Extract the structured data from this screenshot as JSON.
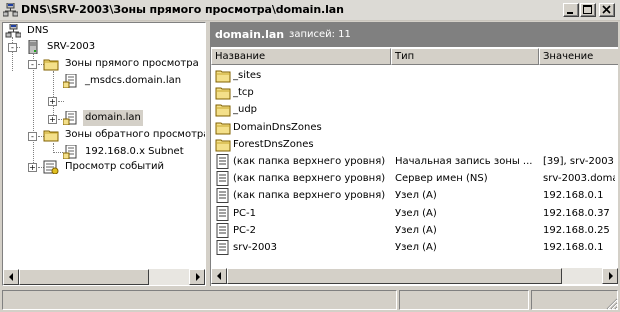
{
  "window": {
    "title": "DNS\\SRV-2003\\Зоны прямого просмотра\\domain.lan"
  },
  "tree": {
    "items": [
      {
        "label": "DNS",
        "icon": "dns-console-icon"
      },
      {
        "label": "SRV-2003",
        "icon": "server-icon"
      },
      {
        "label": "Зоны прямого просмотра",
        "icon": "folder-icon"
      },
      {
        "label": "_msdcs.domain.lan",
        "icon": "zone-icon"
      },
      {
        "label": "domain.lan",
        "icon": "zone-icon",
        "selected": true
      },
      {
        "label": "Зоны обратного просмотра",
        "icon": "folder-icon"
      },
      {
        "label": "192.168.0.x Subnet",
        "icon": "zone-icon"
      },
      {
        "label": "Просмотр событий",
        "icon": "event-viewer-icon"
      }
    ]
  },
  "main": {
    "title": "domain.lan",
    "count_label": "записей: 11",
    "columns": [
      "Название",
      "Тип",
      "Значение"
    ],
    "rows": [
      {
        "name": "_sites",
        "type": "",
        "value": "",
        "icon": "folder-icon"
      },
      {
        "name": "_tcp",
        "type": "",
        "value": "",
        "icon": "folder-icon"
      },
      {
        "name": "_udp",
        "type": "",
        "value": "",
        "icon": "folder-icon"
      },
      {
        "name": "DomainDnsZones",
        "type": "",
        "value": "",
        "icon": "folder-icon"
      },
      {
        "name": "ForestDnsZones",
        "type": "",
        "value": "",
        "icon": "folder-icon"
      },
      {
        "name": "(как папка верхнего уровня)",
        "type": "Начальная запись зоны ...",
        "value": "[39], srv-2003",
        "icon": "record-icon"
      },
      {
        "name": "(как папка верхнего уровня)",
        "type": "Сервер имен (NS)",
        "value": "srv-2003.doma",
        "icon": "record-icon"
      },
      {
        "name": "(как папка верхнего уровня)",
        "type": "Узел (A)",
        "value": "192.168.0.1",
        "icon": "record-icon"
      },
      {
        "name": "PC-1",
        "type": "Узел (A)",
        "value": "192.168.0.37",
        "icon": "record-icon"
      },
      {
        "name": "PC-2",
        "type": "Узел (A)",
        "value": "192.168.0.25",
        "icon": "record-icon"
      },
      {
        "name": "srv-2003",
        "type": "Узел (A)",
        "value": "192.168.0.1",
        "icon": "record-icon"
      }
    ]
  }
}
